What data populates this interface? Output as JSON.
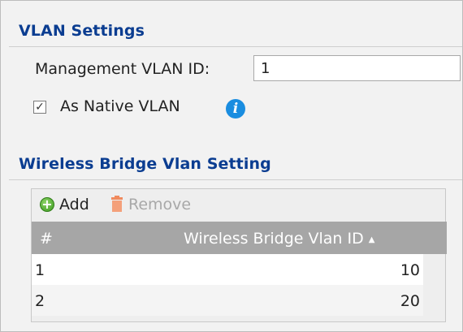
{
  "vlan_settings": {
    "title": "VLAN Settings",
    "management_label": "Management VLAN ID:",
    "management_value": "1",
    "native_label": "As Native VLAN",
    "native_checked": true
  },
  "bridge": {
    "title": "Wireless Bridge Vlan Setting",
    "add_label": "Add",
    "remove_label": "Remove",
    "columns": [
      "#",
      "Wireless Bridge Vlan ID"
    ],
    "rows": [
      {
        "num": "1",
        "vlan_id": "10"
      },
      {
        "num": "2",
        "vlan_id": "20"
      }
    ]
  },
  "colors": {
    "title": "#0b3d91",
    "header_bg": "#a6a6a6",
    "info": "#1a8de0",
    "add": "#3c9a1e",
    "remove_disabled": "#a8a8a8"
  },
  "icons": [
    "info-icon",
    "add-circle-icon",
    "trash-icon",
    "sort-ascending-icon",
    "checkbox-checked-icon"
  ]
}
